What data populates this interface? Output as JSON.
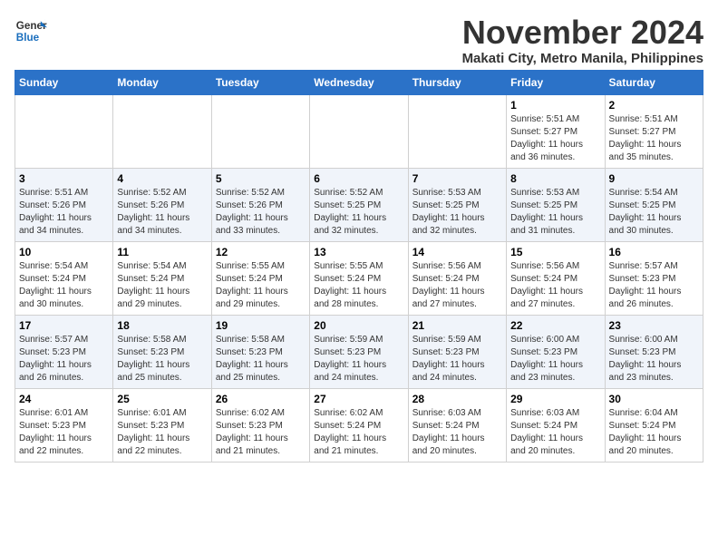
{
  "logo": {
    "line1": "General",
    "line2": "Blue"
  },
  "title": "November 2024",
  "subtitle": "Makati City, Metro Manila, Philippines",
  "weekdays": [
    "Sunday",
    "Monday",
    "Tuesday",
    "Wednesday",
    "Thursday",
    "Friday",
    "Saturday"
  ],
  "weeks": [
    [
      {
        "day": "",
        "info": ""
      },
      {
        "day": "",
        "info": ""
      },
      {
        "day": "",
        "info": ""
      },
      {
        "day": "",
        "info": ""
      },
      {
        "day": "",
        "info": ""
      },
      {
        "day": "1",
        "info": "Sunrise: 5:51 AM\nSunset: 5:27 PM\nDaylight: 11 hours\nand 36 minutes."
      },
      {
        "day": "2",
        "info": "Sunrise: 5:51 AM\nSunset: 5:27 PM\nDaylight: 11 hours\nand 35 minutes."
      }
    ],
    [
      {
        "day": "3",
        "info": "Sunrise: 5:51 AM\nSunset: 5:26 PM\nDaylight: 11 hours\nand 34 minutes."
      },
      {
        "day": "4",
        "info": "Sunrise: 5:52 AM\nSunset: 5:26 PM\nDaylight: 11 hours\nand 34 minutes."
      },
      {
        "day": "5",
        "info": "Sunrise: 5:52 AM\nSunset: 5:26 PM\nDaylight: 11 hours\nand 33 minutes."
      },
      {
        "day": "6",
        "info": "Sunrise: 5:52 AM\nSunset: 5:25 PM\nDaylight: 11 hours\nand 32 minutes."
      },
      {
        "day": "7",
        "info": "Sunrise: 5:53 AM\nSunset: 5:25 PM\nDaylight: 11 hours\nand 32 minutes."
      },
      {
        "day": "8",
        "info": "Sunrise: 5:53 AM\nSunset: 5:25 PM\nDaylight: 11 hours\nand 31 minutes."
      },
      {
        "day": "9",
        "info": "Sunrise: 5:54 AM\nSunset: 5:25 PM\nDaylight: 11 hours\nand 30 minutes."
      }
    ],
    [
      {
        "day": "10",
        "info": "Sunrise: 5:54 AM\nSunset: 5:24 PM\nDaylight: 11 hours\nand 30 minutes."
      },
      {
        "day": "11",
        "info": "Sunrise: 5:54 AM\nSunset: 5:24 PM\nDaylight: 11 hours\nand 29 minutes."
      },
      {
        "day": "12",
        "info": "Sunrise: 5:55 AM\nSunset: 5:24 PM\nDaylight: 11 hours\nand 29 minutes."
      },
      {
        "day": "13",
        "info": "Sunrise: 5:55 AM\nSunset: 5:24 PM\nDaylight: 11 hours\nand 28 minutes."
      },
      {
        "day": "14",
        "info": "Sunrise: 5:56 AM\nSunset: 5:24 PM\nDaylight: 11 hours\nand 27 minutes."
      },
      {
        "day": "15",
        "info": "Sunrise: 5:56 AM\nSunset: 5:24 PM\nDaylight: 11 hours\nand 27 minutes."
      },
      {
        "day": "16",
        "info": "Sunrise: 5:57 AM\nSunset: 5:23 PM\nDaylight: 11 hours\nand 26 minutes."
      }
    ],
    [
      {
        "day": "17",
        "info": "Sunrise: 5:57 AM\nSunset: 5:23 PM\nDaylight: 11 hours\nand 26 minutes."
      },
      {
        "day": "18",
        "info": "Sunrise: 5:58 AM\nSunset: 5:23 PM\nDaylight: 11 hours\nand 25 minutes."
      },
      {
        "day": "19",
        "info": "Sunrise: 5:58 AM\nSunset: 5:23 PM\nDaylight: 11 hours\nand 25 minutes."
      },
      {
        "day": "20",
        "info": "Sunrise: 5:59 AM\nSunset: 5:23 PM\nDaylight: 11 hours\nand 24 minutes."
      },
      {
        "day": "21",
        "info": "Sunrise: 5:59 AM\nSunset: 5:23 PM\nDaylight: 11 hours\nand 24 minutes."
      },
      {
        "day": "22",
        "info": "Sunrise: 6:00 AM\nSunset: 5:23 PM\nDaylight: 11 hours\nand 23 minutes."
      },
      {
        "day": "23",
        "info": "Sunrise: 6:00 AM\nSunset: 5:23 PM\nDaylight: 11 hours\nand 23 minutes."
      }
    ],
    [
      {
        "day": "24",
        "info": "Sunrise: 6:01 AM\nSunset: 5:23 PM\nDaylight: 11 hours\nand 22 minutes."
      },
      {
        "day": "25",
        "info": "Sunrise: 6:01 AM\nSunset: 5:23 PM\nDaylight: 11 hours\nand 22 minutes."
      },
      {
        "day": "26",
        "info": "Sunrise: 6:02 AM\nSunset: 5:23 PM\nDaylight: 11 hours\nand 21 minutes."
      },
      {
        "day": "27",
        "info": "Sunrise: 6:02 AM\nSunset: 5:24 PM\nDaylight: 11 hours\nand 21 minutes."
      },
      {
        "day": "28",
        "info": "Sunrise: 6:03 AM\nSunset: 5:24 PM\nDaylight: 11 hours\nand 20 minutes."
      },
      {
        "day": "29",
        "info": "Sunrise: 6:03 AM\nSunset: 5:24 PM\nDaylight: 11 hours\nand 20 minutes."
      },
      {
        "day": "30",
        "info": "Sunrise: 6:04 AM\nSunset: 5:24 PM\nDaylight: 11 hours\nand 20 minutes."
      }
    ]
  ]
}
